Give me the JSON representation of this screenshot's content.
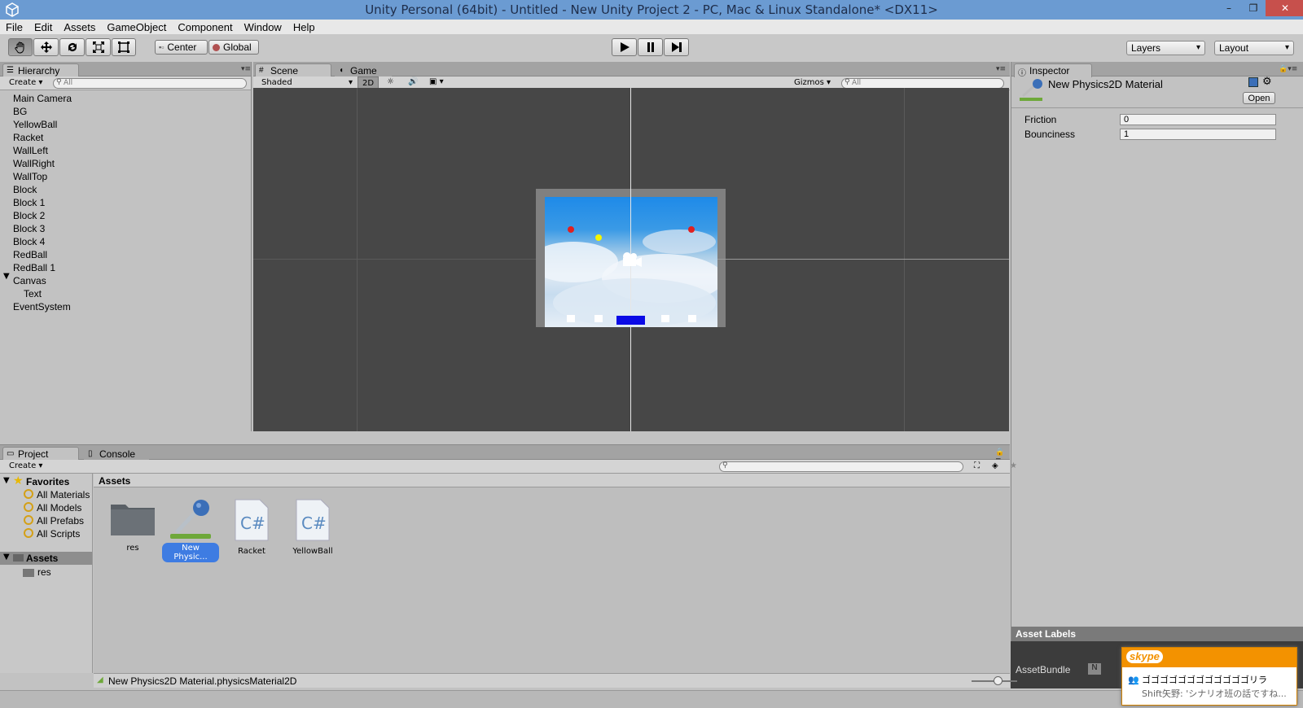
{
  "window": {
    "title": "Unity Personal (64bit) - Untitled - New Unity Project 2 - PC, Mac & Linux Standalone* <DX11>",
    "minimize": "–",
    "restore": "❐",
    "close": "✕"
  },
  "menu": [
    "File",
    "Edit",
    "Assets",
    "GameObject",
    "Component",
    "Window",
    "Help"
  ],
  "toolbar": {
    "pivot": "Center",
    "space": "Global",
    "layers": "Layers",
    "layout": "Layout"
  },
  "hierarchy": {
    "tab": "Hierarchy",
    "create": "Create",
    "search_placeholder": "All",
    "items": [
      "Main Camera",
      "BG",
      "YellowBall",
      "Racket",
      "WallLeft",
      "WallRight",
      "WallTop",
      "Block",
      "Block 1",
      "Block 2",
      "Block 3",
      "Block 4",
      "RedBall",
      "RedBall 1",
      "Canvas",
      "Text",
      "EventSystem"
    ]
  },
  "scene": {
    "tab_scene": "Scene",
    "tab_game": "Game",
    "shading": "Shaded",
    "mode_2d": "2D",
    "gizmos": "Gizmos",
    "search_placeholder": "All"
  },
  "inspector": {
    "tab": "Inspector",
    "asset_name": "New Physics2D Material",
    "open_button": "Open",
    "friction_label": "Friction",
    "friction_value": "0",
    "bounciness_label": "Bounciness",
    "bounciness_value": "1",
    "asset_labels": "Asset Labels",
    "asset_bundle": "AssetBundle",
    "asset_bundle_value": "N"
  },
  "project": {
    "tab_project": "Project",
    "tab_console": "Console",
    "create": "Create",
    "favorites": "Favorites",
    "favorite_items": [
      "All Materials",
      "All Models",
      "All Prefabs",
      "All Scripts"
    ],
    "assets_root": "Assets",
    "assets_children": [
      "res"
    ],
    "breadcrumb": "Assets",
    "assets": [
      {
        "name": "res",
        "icon": "folder-icon"
      },
      {
        "name": "New Physic...",
        "icon": "physics-material-icon"
      },
      {
        "name": "Racket",
        "icon": "csharp-script-icon"
      },
      {
        "name": "YellowBall",
        "icon": "csharp-script-icon"
      }
    ],
    "status_path": "New Physics2D Material.physicsMaterial2D"
  },
  "notification": {
    "app": "skype",
    "line1": "ゴゴゴゴゴゴゴゴゴゴゴゴリラ",
    "line2": "Shift矢野: 'シナリオ班の話ですね..."
  },
  "colors": {
    "title_bar": "#6b9bd2",
    "selection": "#3e7ce2",
    "skype_orange": "#f39200",
    "ball_yellow": "#f5f500",
    "ball_red": "#e02020",
    "racket_blue": "#0a0ae6"
  }
}
